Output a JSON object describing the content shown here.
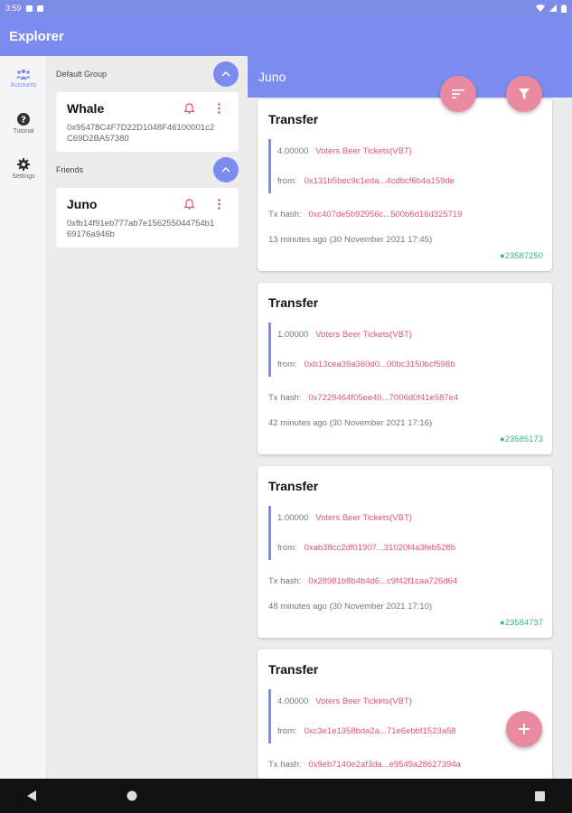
{
  "status_bar": {
    "time": "3:59"
  },
  "app_bar": {
    "title": "Explorer"
  },
  "rail": [
    {
      "label": "Accounts",
      "icon": "accounts-icon",
      "active": true
    },
    {
      "label": "Tutorial",
      "icon": "help-icon",
      "active": false
    },
    {
      "label": "Settings",
      "icon": "gear-icon",
      "active": false
    }
  ],
  "groups": [
    {
      "name": "Default Group",
      "accounts": [
        {
          "name": "Whale",
          "address": "0x95478C4F7D22D1048F46100001c2C69D2BA57380"
        }
      ]
    },
    {
      "name": "Friends",
      "accounts": [
        {
          "name": "Juno",
          "address": "0xfb14f91eb777ab7e156255044754b169176a946b"
        }
      ]
    }
  ],
  "feed": {
    "title": "Juno",
    "transactions": [
      {
        "title": "Transfer",
        "amount": "4.00000",
        "token": "Voters Beer Tickets(VBT)",
        "from_label": "from:",
        "from": "0x131b5bec9c1eda...4cdbcf6b4a159de",
        "hash_label": "Tx hash:",
        "hash": "0xc407de5b92956c...500b5d16d325719",
        "time": "13 minutes ago (30 November 2021 17:45)",
        "block": "●23587250"
      },
      {
        "title": "Transfer",
        "amount": "1.00000",
        "token": "Voters Beer Tickets(VBT)",
        "from_label": "from:",
        "from": "0xb13cea39a360d0...00bc3150bcf598b",
        "hash_label": "Tx hash:",
        "hash": "0x7229464f05ee40...7006d0f41e587e4",
        "time": "42 minutes ago (30 November 2021 17:16)",
        "block": "●23585173"
      },
      {
        "title": "Transfer",
        "amount": "1.00000",
        "token": "Voters Beer Tickets(VBT)",
        "from_label": "from:",
        "from": "0xab38cc2df01907...31020f4a3feb528b",
        "hash_label": "Tx hash:",
        "hash": "0x28981b8b4b4d6...c9f42f1caa726d64",
        "time": "48 minutes ago (30 November 2021 17:10)",
        "block": "●23584737"
      },
      {
        "title": "Transfer",
        "amount": "4.00000",
        "token": "Voters Beer Tickets(VBT)",
        "from_label": "from:",
        "from": "0xc3e1e1358bda2a...71e6ebbf1523a58",
        "hash_label": "Tx hash:",
        "hash": "0x9eb7140e2af3da...e9549a28627394a",
        "time": "",
        "block": ""
      }
    ]
  },
  "colors": {
    "primary": "#7b8cee",
    "accent": "#ea8aa0",
    "link": "#e05478",
    "block": "#3cb878"
  }
}
